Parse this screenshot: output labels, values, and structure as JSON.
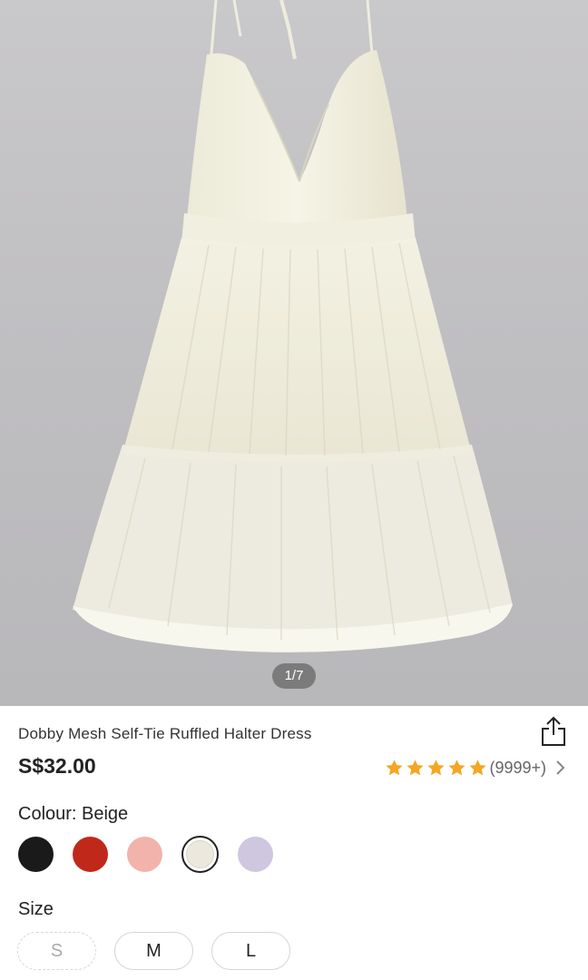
{
  "gallery": {
    "image_alt": "Beige ruffled halter dress on grey background",
    "counter": "1/7"
  },
  "product": {
    "title": "Dobby Mesh Self-Tie Ruffled Halter Dress",
    "price": "S$32.00",
    "rating_stars": 5,
    "review_count": "(9999+)"
  },
  "colour": {
    "label": "Colour: Beige",
    "options": [
      {
        "name": "black",
        "hex": "#1a1a1a",
        "selected": false
      },
      {
        "name": "red",
        "hex": "#c0291a",
        "selected": false
      },
      {
        "name": "pink",
        "hex": "#f2b3ad",
        "selected": false
      },
      {
        "name": "beige",
        "hex": "#ece8dd",
        "selected": true
      },
      {
        "name": "lilac",
        "hex": "#cfc7e0",
        "selected": false
      }
    ]
  },
  "size": {
    "label": "Size",
    "options": [
      {
        "label": "S",
        "available": false
      },
      {
        "label": "M",
        "available": true
      },
      {
        "label": "L",
        "available": true
      }
    ]
  },
  "colors": {
    "star": "#f5a623",
    "text_primary": "#222222",
    "background": "#ffffff"
  },
  "icons": {
    "share": "share-icon",
    "star": "star-icon",
    "chevron": "chevron-right-icon"
  }
}
